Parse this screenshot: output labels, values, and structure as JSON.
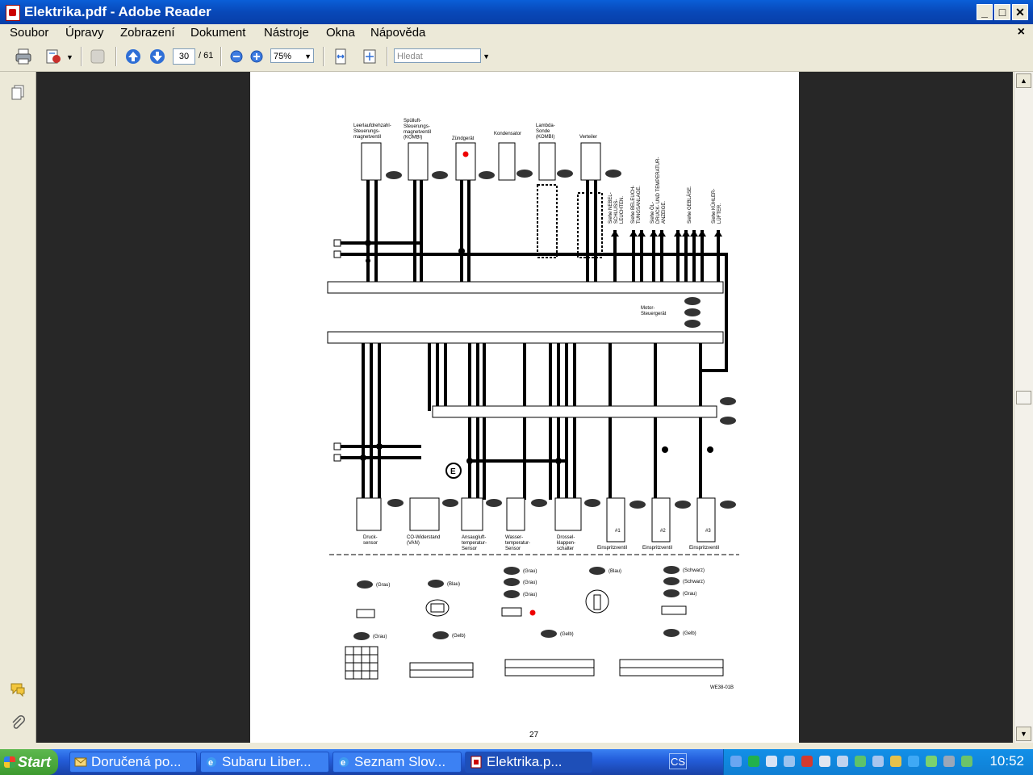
{
  "window": {
    "title": "Elektrika.pdf - Adobe Reader"
  },
  "menu": [
    "Soubor",
    "Úpravy",
    "Zobrazení",
    "Dokument",
    "Nástroje",
    "Okna",
    "Nápověda"
  ],
  "toolbar": {
    "current_page": "30",
    "page_total": "/ 61",
    "zoom": "75%",
    "search_placeholder": "Hledat"
  },
  "page": {
    "page_number": "27",
    "figure_code": "WE38-01B",
    "top_labels": {
      "idle": "Leerlaufdrehzahl-\nSteuerungs-\nmagnetventil",
      "purge": "Spülluft-\nSteuerungs-\nmagnetventil\n(KOMBI)",
      "igniter": "Zündgerät",
      "condenser": "Kondensator",
      "lambda": "Lambda-\nSonde\n(KOMBI)",
      "distributor": "Verteiler"
    },
    "vertical_labels": [
      "Siehe NEBEL-\nSCHLUSS-\nLEUCHTEN.",
      "Siehe BELEUCH-\nTUNGSANLAGE.",
      "Siehe ÖL-\nDRUCK- UND TEMPERATUR-\nANZEIGE.",
      "Siehe GEBLÄSE.",
      "Siehe KÜHLER-\nLÜFTER."
    ],
    "ecu_label": "Motor-\nSteuergerät",
    "bottom_labels": {
      "pressure": "Druck-\nsensor",
      "co": "CO-Widerstand\n(VAN)",
      "intake": "Ansaugluft-\ntemperatur-\nSensor",
      "water": "Wasser-\ntemperatur-\nSensor",
      "throttle": "Drossel-\nklappen-\nschalter",
      "inj1": "Einspritzventil",
      "inj2": "Einspritzventil",
      "inj3": "Einspritzventil"
    },
    "injector_nums": [
      "#1",
      "#2",
      "#3"
    ],
    "legend": {
      "grau": "(Grau)",
      "blau": "(Blau)",
      "schwarz": "(Schwarz)",
      "gelb": "(Gelb)"
    }
  },
  "taskbar": {
    "start": "Start",
    "tasks": [
      "Doručená po...",
      "Subaru Liber...",
      "Seznam Slov...",
      "Elektrika.p..."
    ],
    "lang": "CS",
    "clock": "10:52"
  },
  "colors": {
    "title_blue": "#0848B8",
    "doc_bg": "#272727",
    "taskbar_blue": "#245EDB",
    "start_green": "#3C9A2E"
  }
}
